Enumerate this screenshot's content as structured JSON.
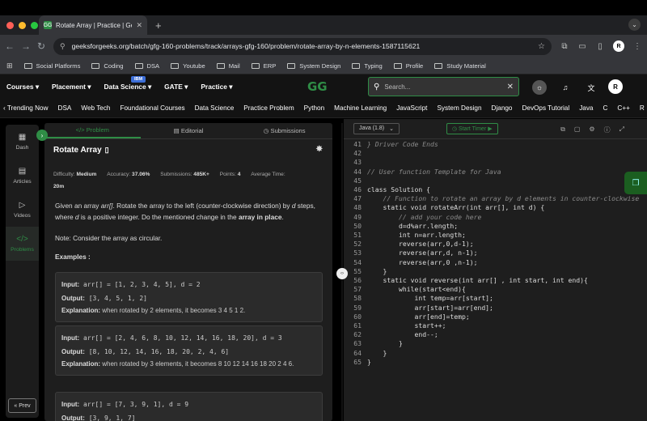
{
  "browser": {
    "tab_title": "Rotate Array | Practice | Geek",
    "tab_favicon": "GG",
    "url": "geeksforgeeks.org/batch/gfg-160-problems/track/arrays-gfg-160/problem/rotate-array-by-n-elements-1587115621",
    "profile_initial": "R"
  },
  "bookmarks": [
    "Social Platforms",
    "Coding",
    "DSA",
    "Youtube",
    "Mail",
    "ERP",
    "System Design",
    "Typing",
    "Profile",
    "Study Material"
  ],
  "gfg": {
    "menu": [
      "Courses ▾",
      "Placement ▾",
      "Data Science ▾",
      "GATE ▾",
      "Practice ▾"
    ],
    "ibm_badge": "IBM",
    "logo": "GG",
    "search_placeholder": "Search...",
    "user_initial": "R",
    "topics": [
      "‹ Trending Now",
      "DSA",
      "Web Tech",
      "Foundational Courses",
      "Data Science",
      "Practice Problem",
      "Python",
      "Machine Learning",
      "JavaScript",
      "System Design",
      "Django",
      "DevOps Tutorial",
      "Java",
      "C",
      "C++",
      "R"
    ]
  },
  "rail": {
    "items": [
      {
        "label": "Dash",
        "icon": "▦"
      },
      {
        "label": "Articles",
        "icon": "▤"
      },
      {
        "label": "Videos",
        "icon": "▷"
      },
      {
        "label": "Problems",
        "icon": "</>"
      }
    ],
    "prev": "« Prev"
  },
  "problem": {
    "tabs": [
      "</> Problem",
      "▤ Editorial",
      "◷ Submissions"
    ],
    "title": "Rotate Array",
    "difficulty_label": "Difficulty:",
    "difficulty": "Medium",
    "accuracy_label": "Accuracy:",
    "accuracy": "37.06%",
    "submissions_label": "Submissions:",
    "submissions": "485K+",
    "points_label": "Points:",
    "points": "4",
    "avg_time_label": "Average Time:",
    "avg_time": "20m",
    "desc_1": "Given an array ",
    "desc_arr": "arr[]",
    "desc_2": ". Rotate the array to the left (counter-clockwise direction) by ",
    "desc_d": "d",
    "desc_3": " steps, where ",
    "desc_d2": "d",
    "desc_4": " is a positive integer. Do the mentioned change in the ",
    "desc_bold": "array in place",
    "desc_5": ".",
    "note": "Note: Consider the array as circular.",
    "examples_heading": "Examples :",
    "examples": [
      {
        "input": "arr[] = [1, 2, 3, 4, 5], d = 2",
        "output": "[3, 4, 5, 1, 2]",
        "explanation": "when rotated by 2 elements, it becomes 3 4 5 1 2."
      },
      {
        "input": "arr[] = [2, 4, 6, 8, 10, 12, 14, 16, 18, 20], d = 3",
        "output": "[8, 10, 12, 14, 16, 18, 20, 2, 4, 6]",
        "explanation": "when rotated by 3 elements, it becomes 8 10 12 14 16 18 20 2 4 6."
      },
      {
        "input": "arr[] = [7, 3, 9, 1], d = 9",
        "output": "[3, 9, 1, 7]",
        "explanation": ""
      }
    ],
    "labels": {
      "input": "Input:",
      "output": "Output:",
      "explanation": "Explanation:"
    }
  },
  "editor": {
    "language": "Java (1.8)",
    "timer": "◷ Start Timer ▶",
    "first_line": 41,
    "code": [
      "} Driver Code Ends",
      "",
      "",
      "// User function Template for Java",
      "",
      "class Solution {",
      "    // Function to rotate an array by d elements in counter-clockwise",
      "    static void rotateArr(int arr[], int d) {",
      "        // add your code here",
      "        d=d%arr.length;",
      "        int n=arr.length;",
      "        reverse(arr,0,d-1);",
      "        reverse(arr,d, n-1);",
      "        reverse(arr,0 ,n-1);",
      "    }",
      "    static void reverse(int arr[] , int start, int end){",
      "        while(start<end){",
      "            int temp=arr[start];",
      "            arr[start]=arr[end];",
      "            arr[end]=temp;",
      "            start++;",
      "            end--;",
      "        }",
      "    }",
      "}"
    ]
  },
  "colors": {
    "accent": "#2f8d46",
    "bg": "#1e1e1e"
  }
}
